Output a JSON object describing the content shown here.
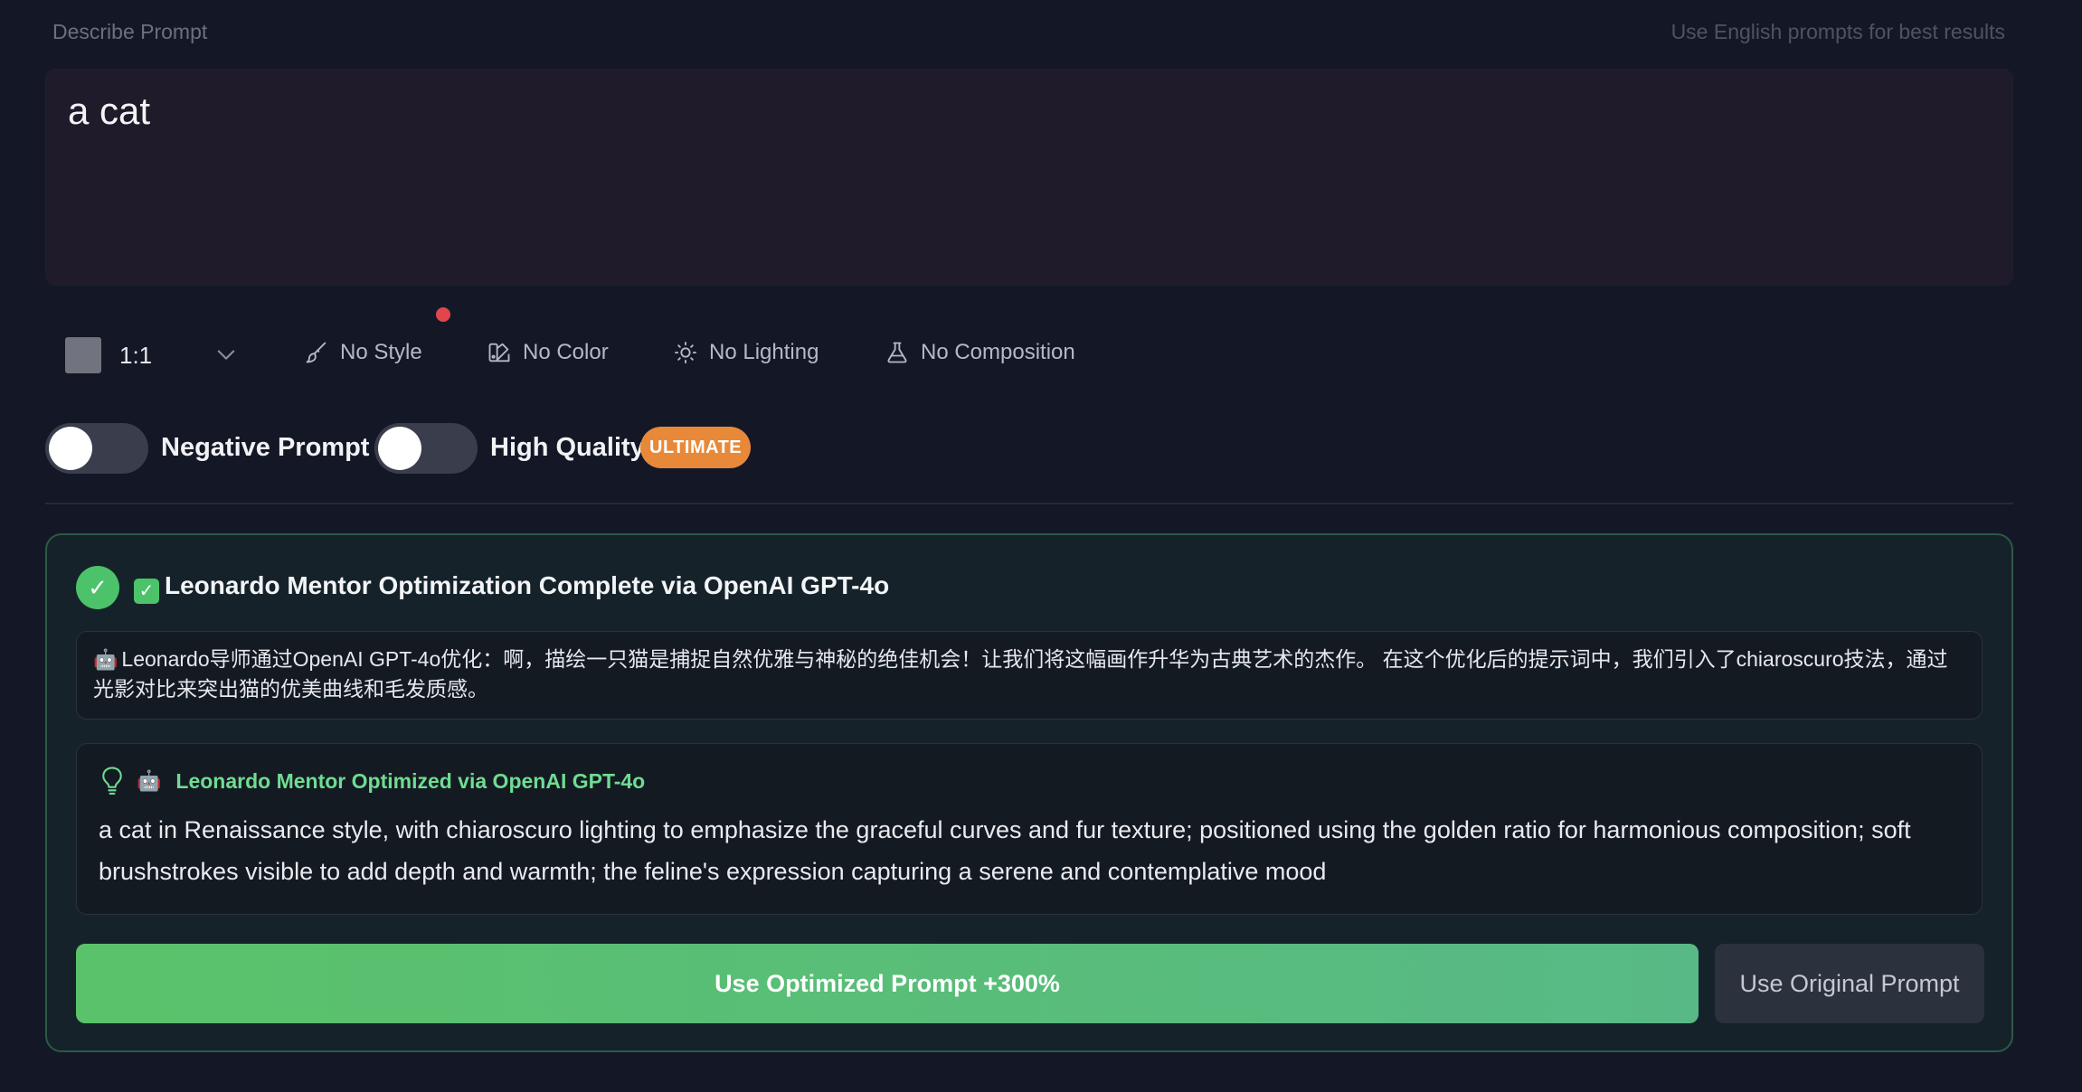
{
  "header": {
    "label": "Describe Prompt",
    "hint": "Use English prompts for best results"
  },
  "prompt": {
    "value": "a cat"
  },
  "toolbar": {
    "aspect_ratio": "1:1",
    "style": "No Style",
    "color": "No Color",
    "lighting": "No Lighting",
    "composition": "No Composition"
  },
  "options": {
    "negative_prompt": {
      "label": "Negative Prompt",
      "enabled": false
    },
    "high_quality": {
      "label": "High Quality",
      "enabled": false,
      "badge": "ULTIMATE"
    }
  },
  "result": {
    "check_mark": "✓",
    "title_emoji": "✓",
    "title": "Leonardo Mentor Optimization Complete via OpenAI GPT-4o",
    "robot_emoji": "🤖",
    "cn_note": "Leonardo导师通过OpenAI GPT-4o优化：啊，描绘一只猫是捕捉自然优雅与神秘的绝佳机会！让我们将这幅画作升华为古典艺术的杰作。 在这个优化后的提示词中，我们引入了chiaroscuro技法，通过光影对比来突出猫的优美曲线和毛发质感。",
    "optimized_heading": "Leonardo Mentor Optimized via OpenAI GPT-4o",
    "optimized_text": "a cat in Renaissance style, with chiaroscuro lighting to emphasize the graceful curves and fur texture; positioned using the golden ratio for harmonious composition; soft brushstrokes visible to add depth and warmth; the feline's expression capturing a serene and contemplative mood",
    "use_optimized_label": "Use Optimized Prompt +300%",
    "use_original_label": "Use Original Prompt"
  },
  "colors": {
    "background": "#141826",
    "accent_green": "#4cc26a",
    "badge_orange": "#e8893a",
    "notification_red": "#e0474c"
  }
}
